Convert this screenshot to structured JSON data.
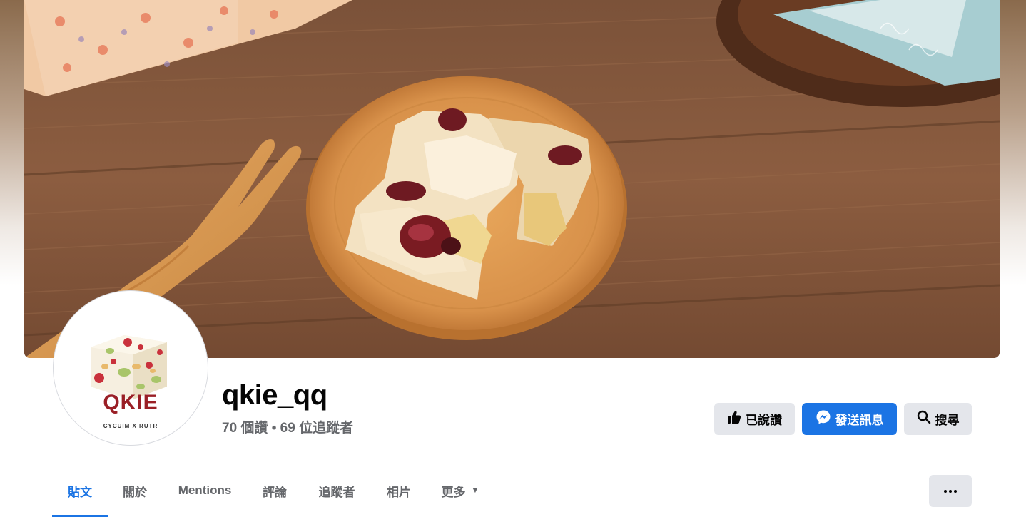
{
  "page": {
    "name": "qkie_qq",
    "stats": "70 個讚 • 69 位追蹤者"
  },
  "avatar": {
    "logo_text": "QKIE",
    "logo_subtext": "CYCUIM X RUTR"
  },
  "actions": {
    "liked_label": "已說讚",
    "message_label": "發送訊息",
    "search_label": "搜尋"
  },
  "tabs": [
    {
      "label": "貼文",
      "active": true
    },
    {
      "label": "關於",
      "active": false
    },
    {
      "label": "Mentions",
      "active": false
    },
    {
      "label": "評論",
      "active": false
    },
    {
      "label": "追蹤者",
      "active": false
    },
    {
      "label": "相片",
      "active": false
    },
    {
      "label": "更多",
      "active": false
    }
  ],
  "icons": {
    "liked": "thumbs-up-icon",
    "message": "messenger-icon",
    "search": "search-icon",
    "more_tab": "caret-down-icon",
    "more_button": "ellipsis-icon"
  },
  "colors": {
    "accent": "#1b74e4",
    "secondary_button": "#e4e6eb",
    "muted_text": "#65676b"
  }
}
